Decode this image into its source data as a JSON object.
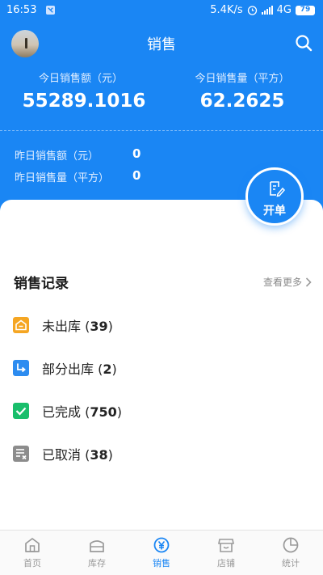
{
  "status": {
    "time": "16:53",
    "net_speed": "5.4K/s",
    "network": "4G",
    "battery": "79"
  },
  "header": {
    "title": "销售"
  },
  "today": {
    "amount_label": "今日销售额（元）",
    "amount_value": "55289.1016",
    "volume_label": "今日销售量（平方）",
    "volume_value": "62.2625"
  },
  "yesterday": {
    "amount_label": "昨日销售额（元）",
    "amount_value": "0",
    "volume_label": "昨日销售量（平方）",
    "volume_value": "0"
  },
  "fab": {
    "label": "开单"
  },
  "records": {
    "title": "销售记录",
    "more_label": "查看更多",
    "items": [
      {
        "label": "未出库",
        "count": "39",
        "icon": "warehouse-icon",
        "color": "#f5a623"
      },
      {
        "label": "部分出库",
        "count": "2",
        "icon": "partial-out-icon",
        "color": "#2d8cf0"
      },
      {
        "label": "已完成",
        "count": "750",
        "icon": "check-icon",
        "color": "#19be6b"
      },
      {
        "label": "已取消",
        "count": "38",
        "icon": "cancel-doc-icon",
        "color": "#8c8c8c"
      }
    ]
  },
  "tabs": [
    {
      "label": "首页",
      "icon": "home-icon"
    },
    {
      "label": "库存",
      "icon": "inventory-icon"
    },
    {
      "label": "销售",
      "icon": "yuan-icon",
      "active": true
    },
    {
      "label": "店铺",
      "icon": "shop-icon"
    },
    {
      "label": "统计",
      "icon": "pie-chart-icon"
    }
  ],
  "colors": {
    "primary": "#1a86f4"
  }
}
